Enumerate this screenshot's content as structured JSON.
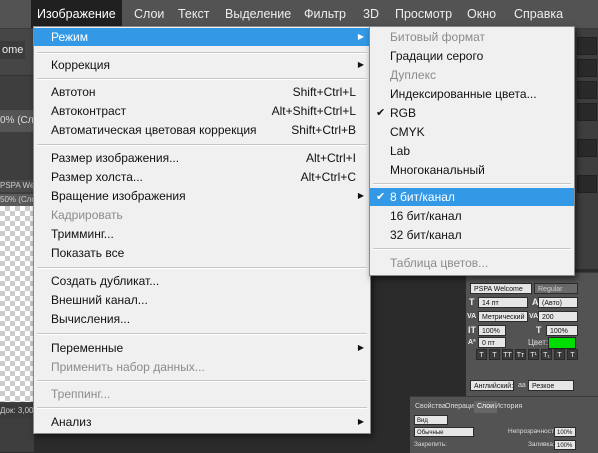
{
  "menubar": {
    "items": [
      "Изображение",
      "Слои",
      "Текст",
      "Выделение",
      "Фильтр",
      "3D",
      "Просмотр",
      "Окно",
      "Справка"
    ]
  },
  "workspace": {
    "options_left_text": "ome",
    "doc_tab": "0% (Сло",
    "doc_tab2": "PSPA Welcome",
    "doc_tab3": "50% (Слой",
    "status": "Док: 3,00М"
  },
  "image_menu": {
    "mode": "Режим",
    "correction": "Коррекция",
    "autotone": "Автотон",
    "autotone_sc": "Shift+Ctrl+L",
    "autocontrast": "Автоконтраст",
    "autocontrast_sc": "Alt+Shift+Ctrl+L",
    "autocolor": "Автоматическая цветовая коррекция",
    "autocolor_sc": "Shift+Ctrl+B",
    "image_size": "Размер изображения...",
    "image_size_sc": "Alt+Ctrl+I",
    "canvas_size": "Размер холста...",
    "canvas_size_sc": "Alt+Ctrl+C",
    "rotate": "Вращение изображения",
    "crop": "Кадрировать",
    "trim": "Тримминг...",
    "reveal_all": "Показать все",
    "duplicate": "Создать дубликат...",
    "apply_image": "Внешний канал...",
    "calculations": "Вычисления...",
    "variables": "Переменные",
    "apply_data_set": "Применить набор данных...",
    "trapping": "Треппинг...",
    "analysis": "Анализ"
  },
  "mode_menu": {
    "bitmap": "Битовый формат",
    "grayscale": "Градации серого",
    "duotone": "Дуплекс",
    "indexed": "Индексированные цвета...",
    "rgb": "RGB",
    "cmyk": "CMYK",
    "lab": "Lab",
    "multichannel": "Многоканальный",
    "bit8": "8 бит/канал",
    "bit16": "16 бит/канал",
    "bit32": "32 бит/канал",
    "color_table": "Таблица цветов...",
    "check": "✔"
  },
  "character_panel": {
    "font": "PSPA Welcome",
    "style": "Regular",
    "size": "14 пт",
    "leading": "(Авто)",
    "kerning": "Метрический",
    "tracking": "200",
    "vscale": "100%",
    "hscale": "100%",
    "baseline": "0 пт",
    "color_label": "Цвет:",
    "color": "#00dd00",
    "language": "Английский: ...",
    "antialias": "Резкое",
    "fmt_buttons": [
      "T",
      "T",
      "TT",
      "Tт",
      "T¹",
      "T₁",
      "T",
      "T"
    ]
  },
  "layers_panel": {
    "tabs": [
      "Свойства",
      "Операции",
      "Слои",
      "История"
    ],
    "kind": "Вид",
    "blend": "Обычные",
    "opacity_label": "Непрозрачность:",
    "opacity": "100%",
    "lock_label": "Закрепить:",
    "fill_label": "Заливка:",
    "fill": "100%"
  }
}
